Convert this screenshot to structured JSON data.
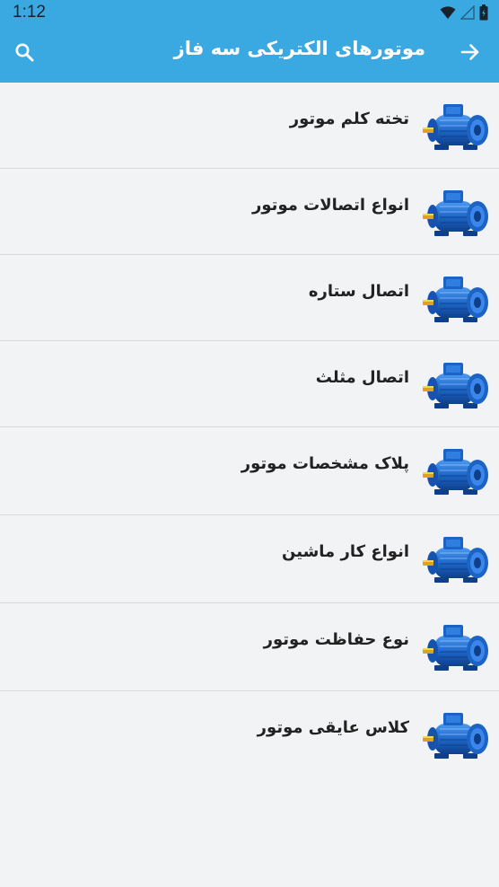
{
  "status_bar": {
    "time": "1:12",
    "icons": [
      "wifi-icon",
      "signal-icon",
      "battery-icon"
    ]
  },
  "app_bar": {
    "title": "موتورهای الکتریکی سه فاز",
    "back_icon": "arrow-right-icon",
    "search_icon": "search-icon"
  },
  "colors": {
    "app_bar": "#3aa9e2",
    "background": "#f2f3f5",
    "divider": "#d6d8db",
    "motor_blue": "#1b63c4",
    "shaft_gold": "#d9a520"
  },
  "topics": [
    {
      "label": "تخته کلم موتور",
      "icon": "electric-motor-icon"
    },
    {
      "label": "انواع اتصالات موتور",
      "icon": "electric-motor-icon"
    },
    {
      "label": "اتصال ستاره",
      "icon": "electric-motor-icon"
    },
    {
      "label": "اتصال مثلث",
      "icon": "electric-motor-icon"
    },
    {
      "label": "پلاک مشخصات موتور",
      "icon": "electric-motor-icon"
    },
    {
      "label": "انواع کار ماشین",
      "icon": "electric-motor-icon"
    },
    {
      "label": "نوع حفاظت موتور",
      "icon": "electric-motor-icon"
    },
    {
      "label": "کلاس عایقی موتور",
      "icon": "electric-motor-icon"
    }
  ]
}
